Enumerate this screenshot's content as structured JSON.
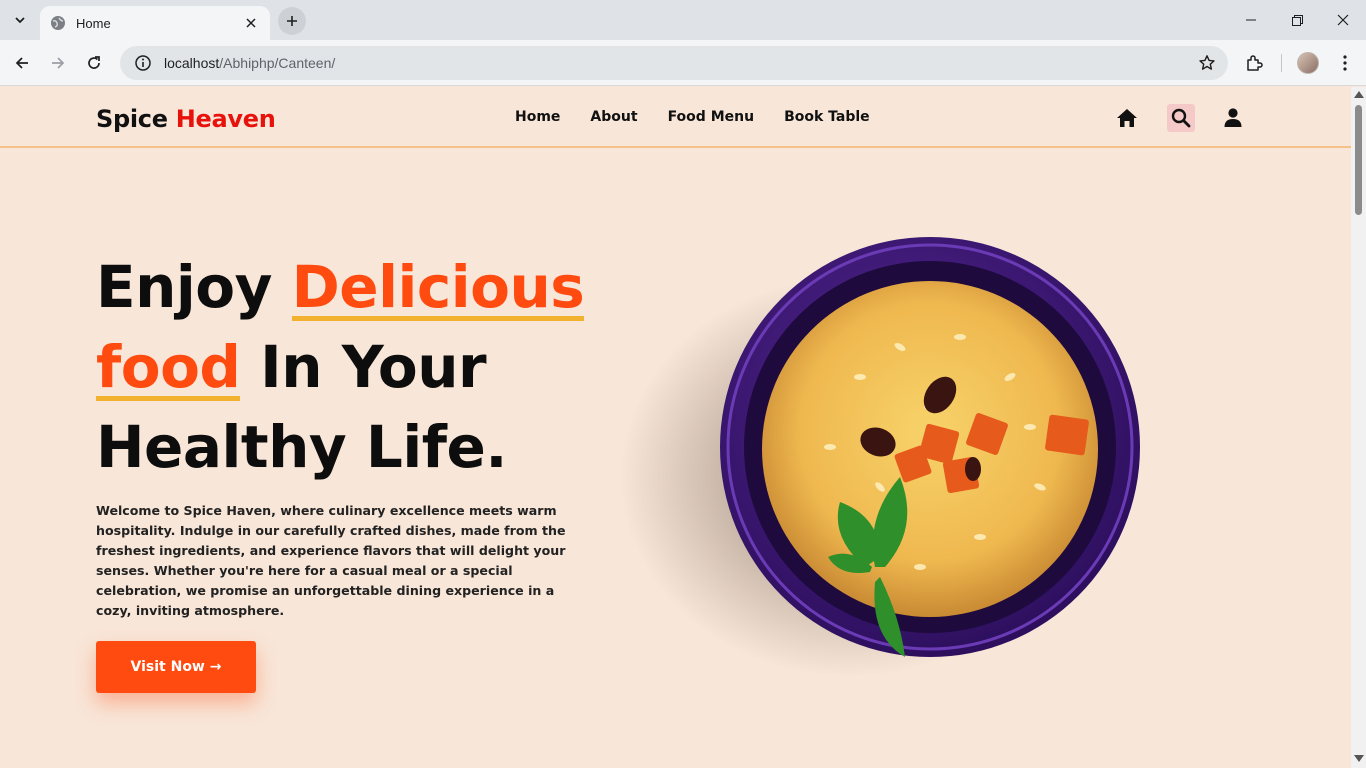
{
  "browser": {
    "tab_title": "Home",
    "url_host": "localhost",
    "url_path": "/Abhiphp/Canteen/"
  },
  "site": {
    "logo_part1": "Spice",
    "logo_part2": "Heaven",
    "menu": [
      "Home",
      "About",
      "Food Menu",
      "Book Table"
    ],
    "icons": [
      "home-icon",
      "search-icon",
      "user-icon"
    ]
  },
  "hero": {
    "title_word1": "Enjoy",
    "title_highlight1": "Delicious",
    "title_highlight2": "food",
    "title_line2_rest": "In Your",
    "title_line3": "Healthy Life.",
    "description": "Welcome to Spice Haven, where culinary excellence meets warm hospitality. Indulge in our carefully crafted dishes, made from the freshest ingredients, and experience flavors that will delight your senses. Whether you're here for a casual meal or a special celebration, we promise an unforgettable dining experience in a cozy, inviting atmosphere.",
    "cta_label": "Visit Now →"
  },
  "colors": {
    "accent": "#ff4a10",
    "logo_red": "#e8120c",
    "underline": "#f2b12e",
    "page_bg": "#f8e6d8"
  }
}
